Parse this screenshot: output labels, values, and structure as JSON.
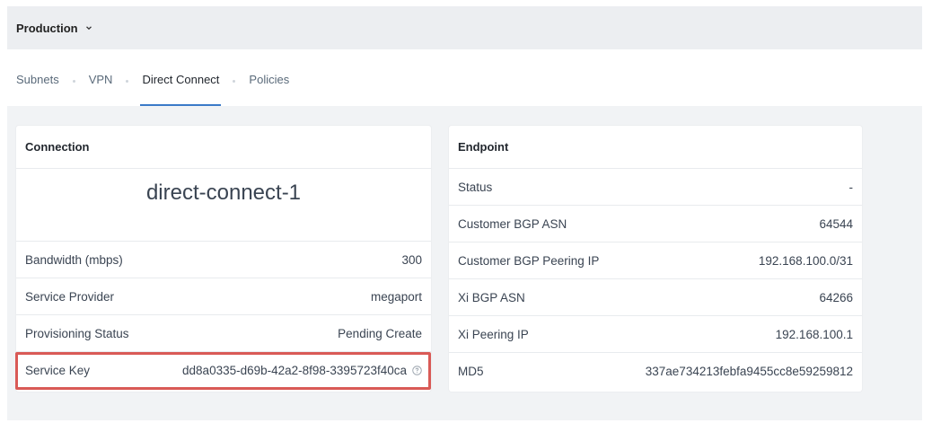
{
  "header": {
    "environment": "Production"
  },
  "tabs": [
    {
      "label": "Subnets"
    },
    {
      "label": "VPN"
    },
    {
      "label": "Direct Connect"
    },
    {
      "label": "Policies"
    }
  ],
  "connection": {
    "title": "Connection",
    "name": "direct-connect-1",
    "rows": [
      {
        "label": "Bandwidth (mbps)",
        "value": "300"
      },
      {
        "label": "Service Provider",
        "value": "megaport"
      },
      {
        "label": "Provisioning Status",
        "value": "Pending Create"
      },
      {
        "label": "Service Key",
        "value": "dd8a0335-d69b-42a2-8f98-3395723f40ca"
      }
    ]
  },
  "endpoint": {
    "title": "Endpoint",
    "rows": [
      {
        "label": "Status",
        "value": "-"
      },
      {
        "label": "Customer BGP ASN",
        "value": "64544"
      },
      {
        "label": "Customer BGP Peering IP",
        "value": "192.168.100.0/31"
      },
      {
        "label": "Xi BGP ASN",
        "value": "64266"
      },
      {
        "label": "Xi Peering IP",
        "value": "192.168.100.1"
      },
      {
        "label": "MD5",
        "value": "337ae734213febfa9455cc8e59259812"
      }
    ]
  },
  "colors": {
    "active_tab_underline": "#3a7ac8",
    "highlight_border": "#d95a56"
  },
  "active_tab": "Direct Connect"
}
